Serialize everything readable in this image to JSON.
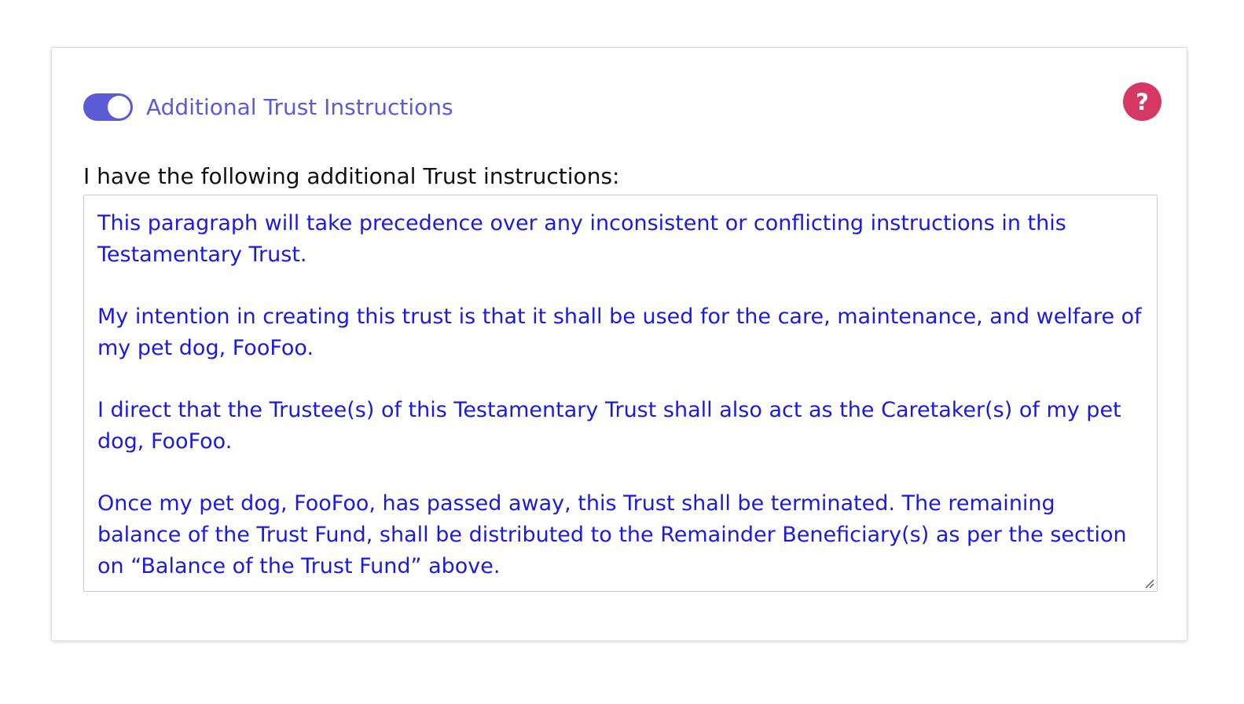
{
  "section": {
    "toggle_on": true,
    "title": "Additional Trust Instructions",
    "help_label": "?",
    "colors": {
      "accent": "#5b5bd6",
      "help": "#d63864",
      "text_input": "#1a1ae0"
    }
  },
  "field": {
    "label": "I have the following additional Trust instructions:",
    "paragraphs": [
      "This paragraph will take precedence over any inconsistent or conflicting instructions in this Testamentary Trust.",
      "My intention in creating this trust is that it shall be used for the care, maintenance, and welfare of my pet dog, FooFoo.",
      "I direct that the Trustee(s) of this Testamentary Trust shall also act as the Caretaker(s) of my pet dog, FooFoo.",
      "Once my pet dog, FooFoo, has passed away, this Trust shall be terminated. The remaining balance of the Trust Fund, shall be distributed to the Remainder Beneficiary(s) as per the section on “Balance of the Trust Fund” above."
    ]
  }
}
